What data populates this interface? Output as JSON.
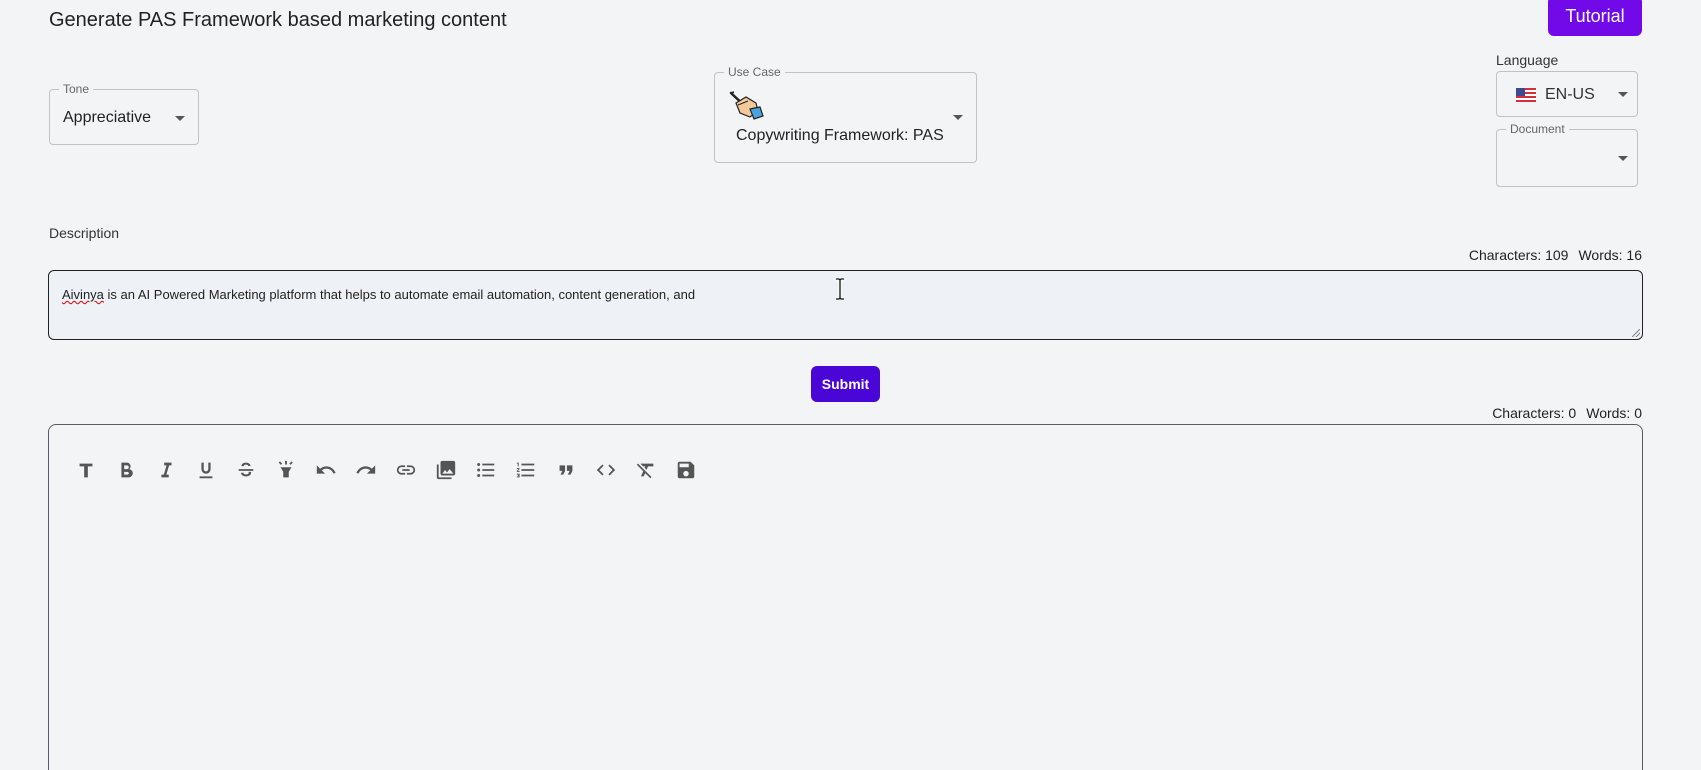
{
  "header": {
    "title": "Generate PAS Framework based marketing content",
    "tutorial_label": "Tutorial"
  },
  "tone": {
    "legend": "Tone",
    "value": "Appreciative"
  },
  "use_case": {
    "legend": "Use Case",
    "value": "Copywriting Framework: PAS",
    "icon": "hand-writing-icon"
  },
  "language": {
    "label": "Language",
    "value": "EN-US",
    "icon": "us-flag-icon"
  },
  "document": {
    "legend": "Document",
    "value": ""
  },
  "description": {
    "label": "Description",
    "chars_label": "Characters: 109",
    "words_label": "Words: 16",
    "text_first_word": "Aivinya",
    "text_rest": " is an AI Powered Marketing platform that helps to automate email automation, content generation, and"
  },
  "submit_label": "Submit",
  "editor": {
    "chars_label": "Characters: 0",
    "words_label": "Words: 0",
    "tools": [
      "text-format-icon",
      "bold-icon",
      "italic-icon",
      "underline-icon",
      "strikethrough-icon",
      "highlight-icon",
      "undo-icon",
      "redo-icon",
      "link-icon",
      "image-icon",
      "bullet-list-icon",
      "numbered-list-icon",
      "quote-icon",
      "code-icon",
      "clear-format-icon",
      "save-icon"
    ]
  },
  "colors": {
    "accent": "#7209e8",
    "submit": "#4a06d6",
    "background": "#f3f4f6"
  }
}
